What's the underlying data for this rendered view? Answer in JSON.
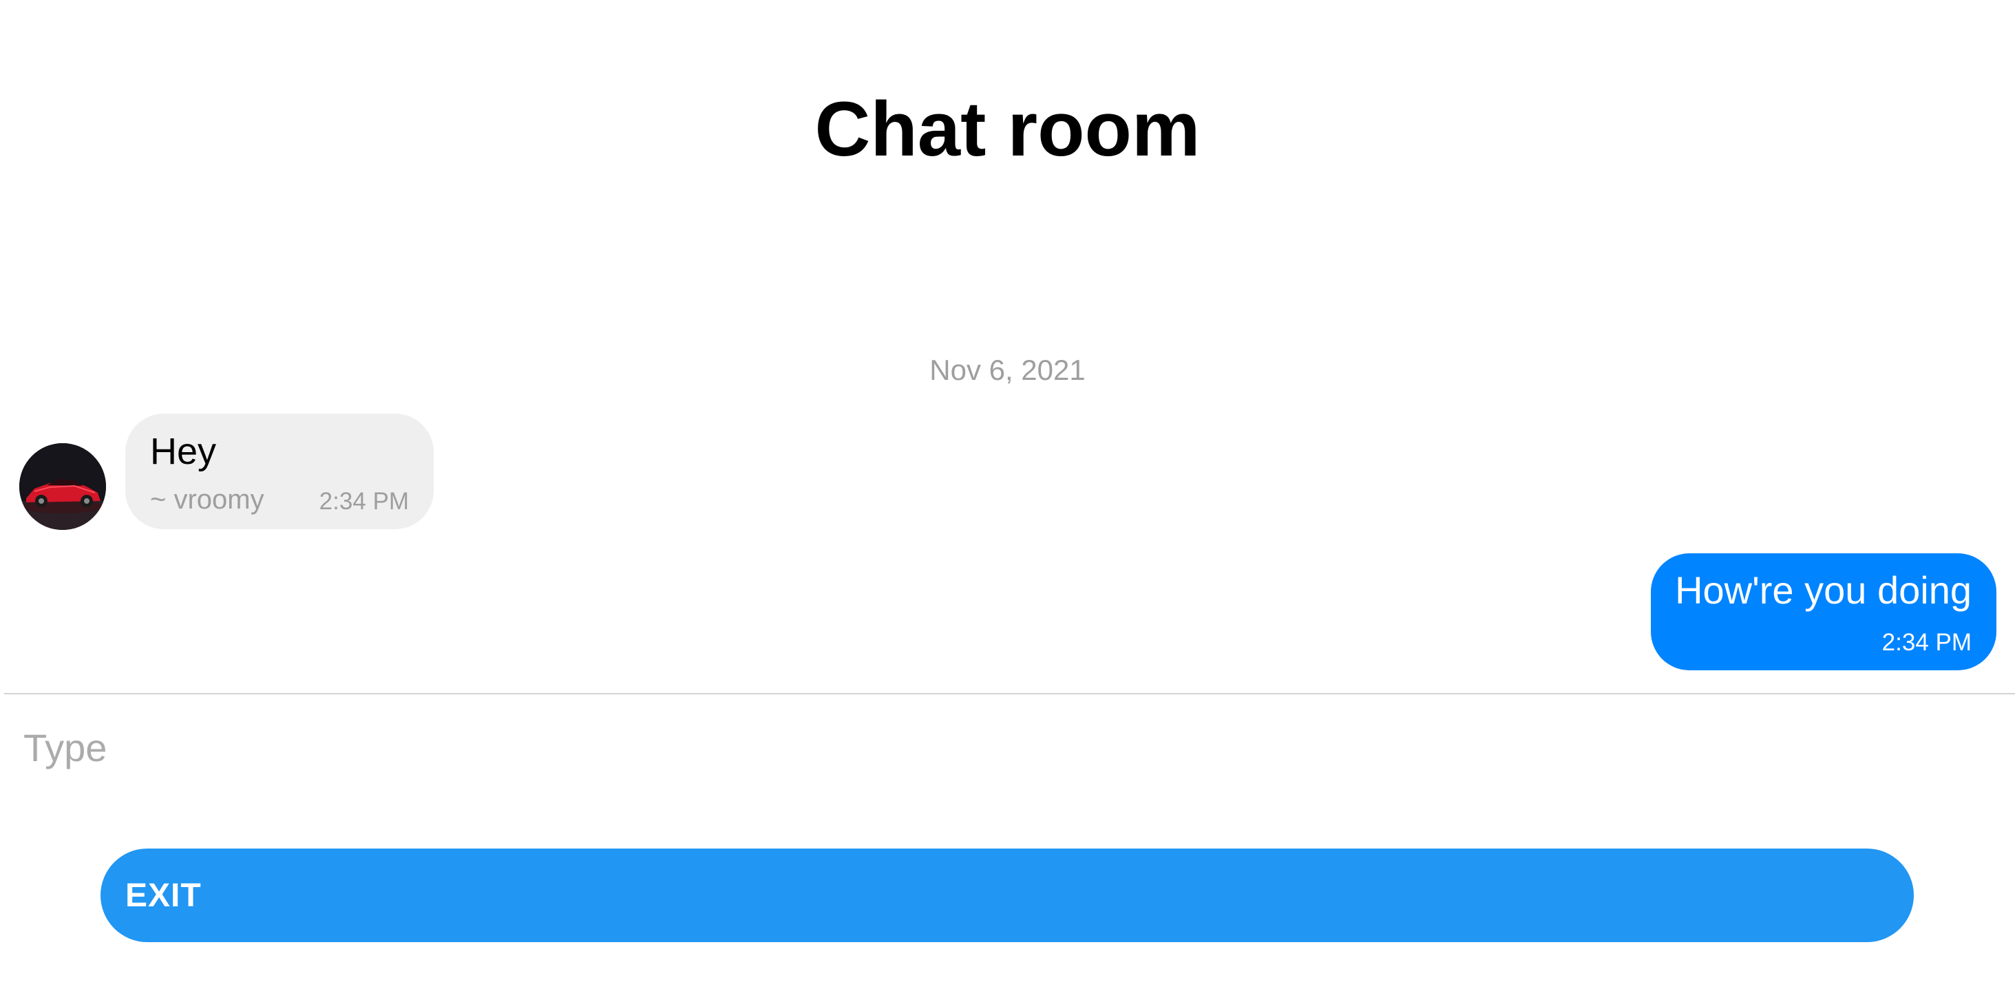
{
  "header": {
    "title": "Chat room"
  },
  "messages": {
    "date_separator": "Nov 6, 2021",
    "items": [
      {
        "direction": "incoming",
        "text": "Hey",
        "sender": "~ vroomy",
        "time": "2:34 PM",
        "avatar": "red-sports-car-photo"
      },
      {
        "direction": "outgoing",
        "text": "How're you doing",
        "time": "2:34 PM"
      }
    ]
  },
  "composer": {
    "placeholder": "Type",
    "value": ""
  },
  "actions": {
    "exit_label": "EXIT"
  },
  "colors": {
    "incoming_bubble": "#efefef",
    "outgoing_bubble": "#0084ff",
    "exit_button": "#2196f3",
    "muted_text": "#9e9e9e"
  }
}
